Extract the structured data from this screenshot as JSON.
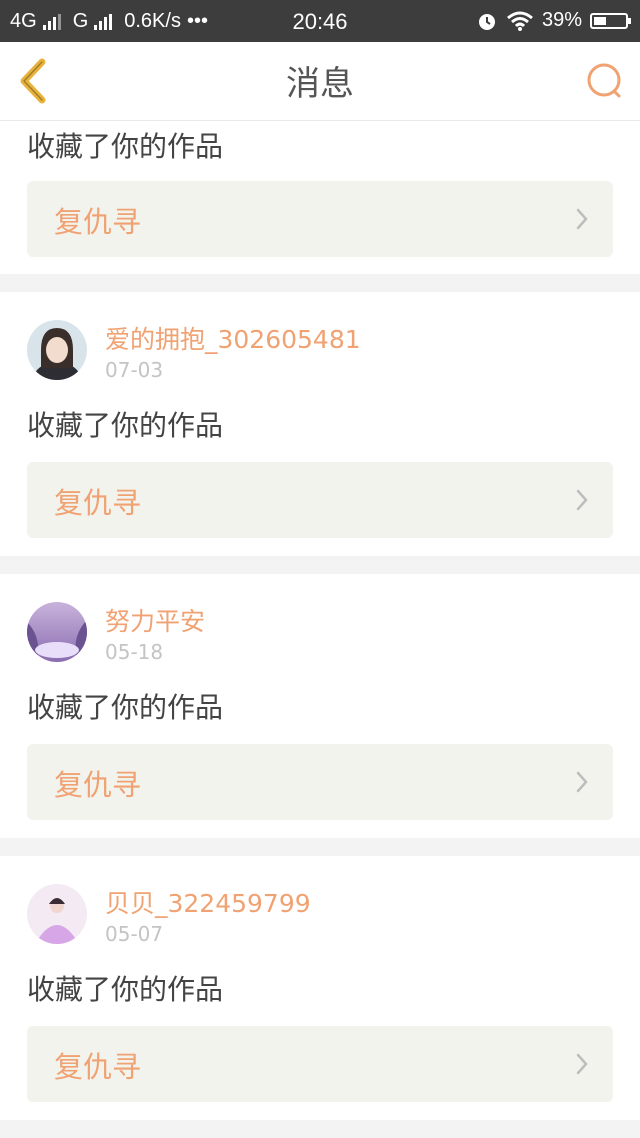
{
  "status_bar": {
    "network_1": "4G",
    "network_2": "G",
    "speed": "0.6K/s",
    "more": "•••",
    "time": "20:46",
    "battery": "39%",
    "battery_level": 0.39
  },
  "nav": {
    "title": "消息",
    "accent_color": "#f0a272",
    "back_color": "#e9b33a"
  },
  "messages": [
    {
      "action": "收藏了你的作品",
      "work_title": "复仇寻"
    },
    {
      "username": "爱的拥抱_302605481",
      "date": "07-03",
      "action": "收藏了你的作品",
      "work_title": "复仇寻"
    },
    {
      "username": "努力平安",
      "date": "05-18",
      "action": "收藏了你的作品",
      "work_title": "复仇寻"
    },
    {
      "username": "贝贝_322459799",
      "date": "05-07",
      "action": "收藏了你的作品",
      "work_title": "复仇寻"
    }
  ]
}
